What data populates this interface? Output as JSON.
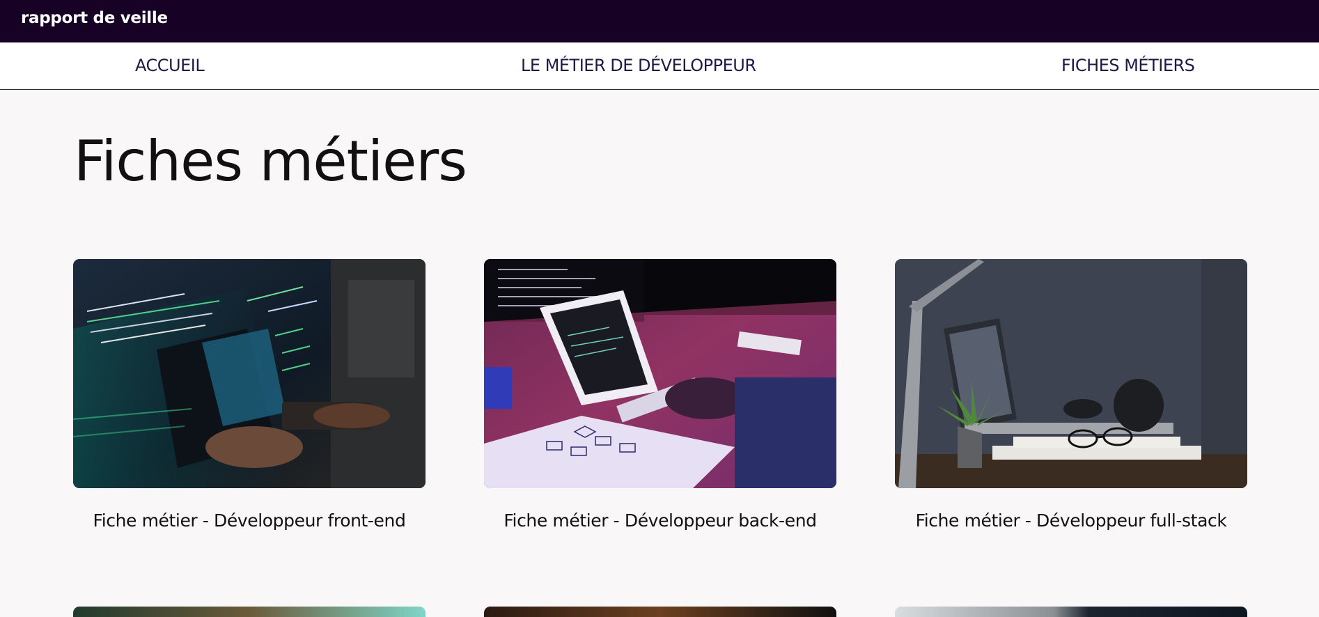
{
  "header": {
    "brand": "rapport de veille",
    "bg": "#170226"
  },
  "nav": {
    "items": [
      {
        "label": "ACCUEIL"
      },
      {
        "label": "LE MÉTIER DE DÉVELOPPEUR"
      },
      {
        "label": "FICHES MÉTIERS"
      }
    ]
  },
  "main": {
    "title": "Fiches métiers",
    "cards": [
      {
        "title": "Fiche métier - Développeur front-end",
        "image": "code-hologram-laptop-photo"
      },
      {
        "title": "Fiche métier - Développeur back-end",
        "image": "tablet-flowchart-desk-photo"
      },
      {
        "title": "Fiche métier - Développeur full-stack",
        "image": "laptop-plant-headphones-photo"
      }
    ],
    "second_row_images": [
      "blurred-office-photo",
      "dark-laptop-photo",
      "code-screen-photo"
    ]
  }
}
